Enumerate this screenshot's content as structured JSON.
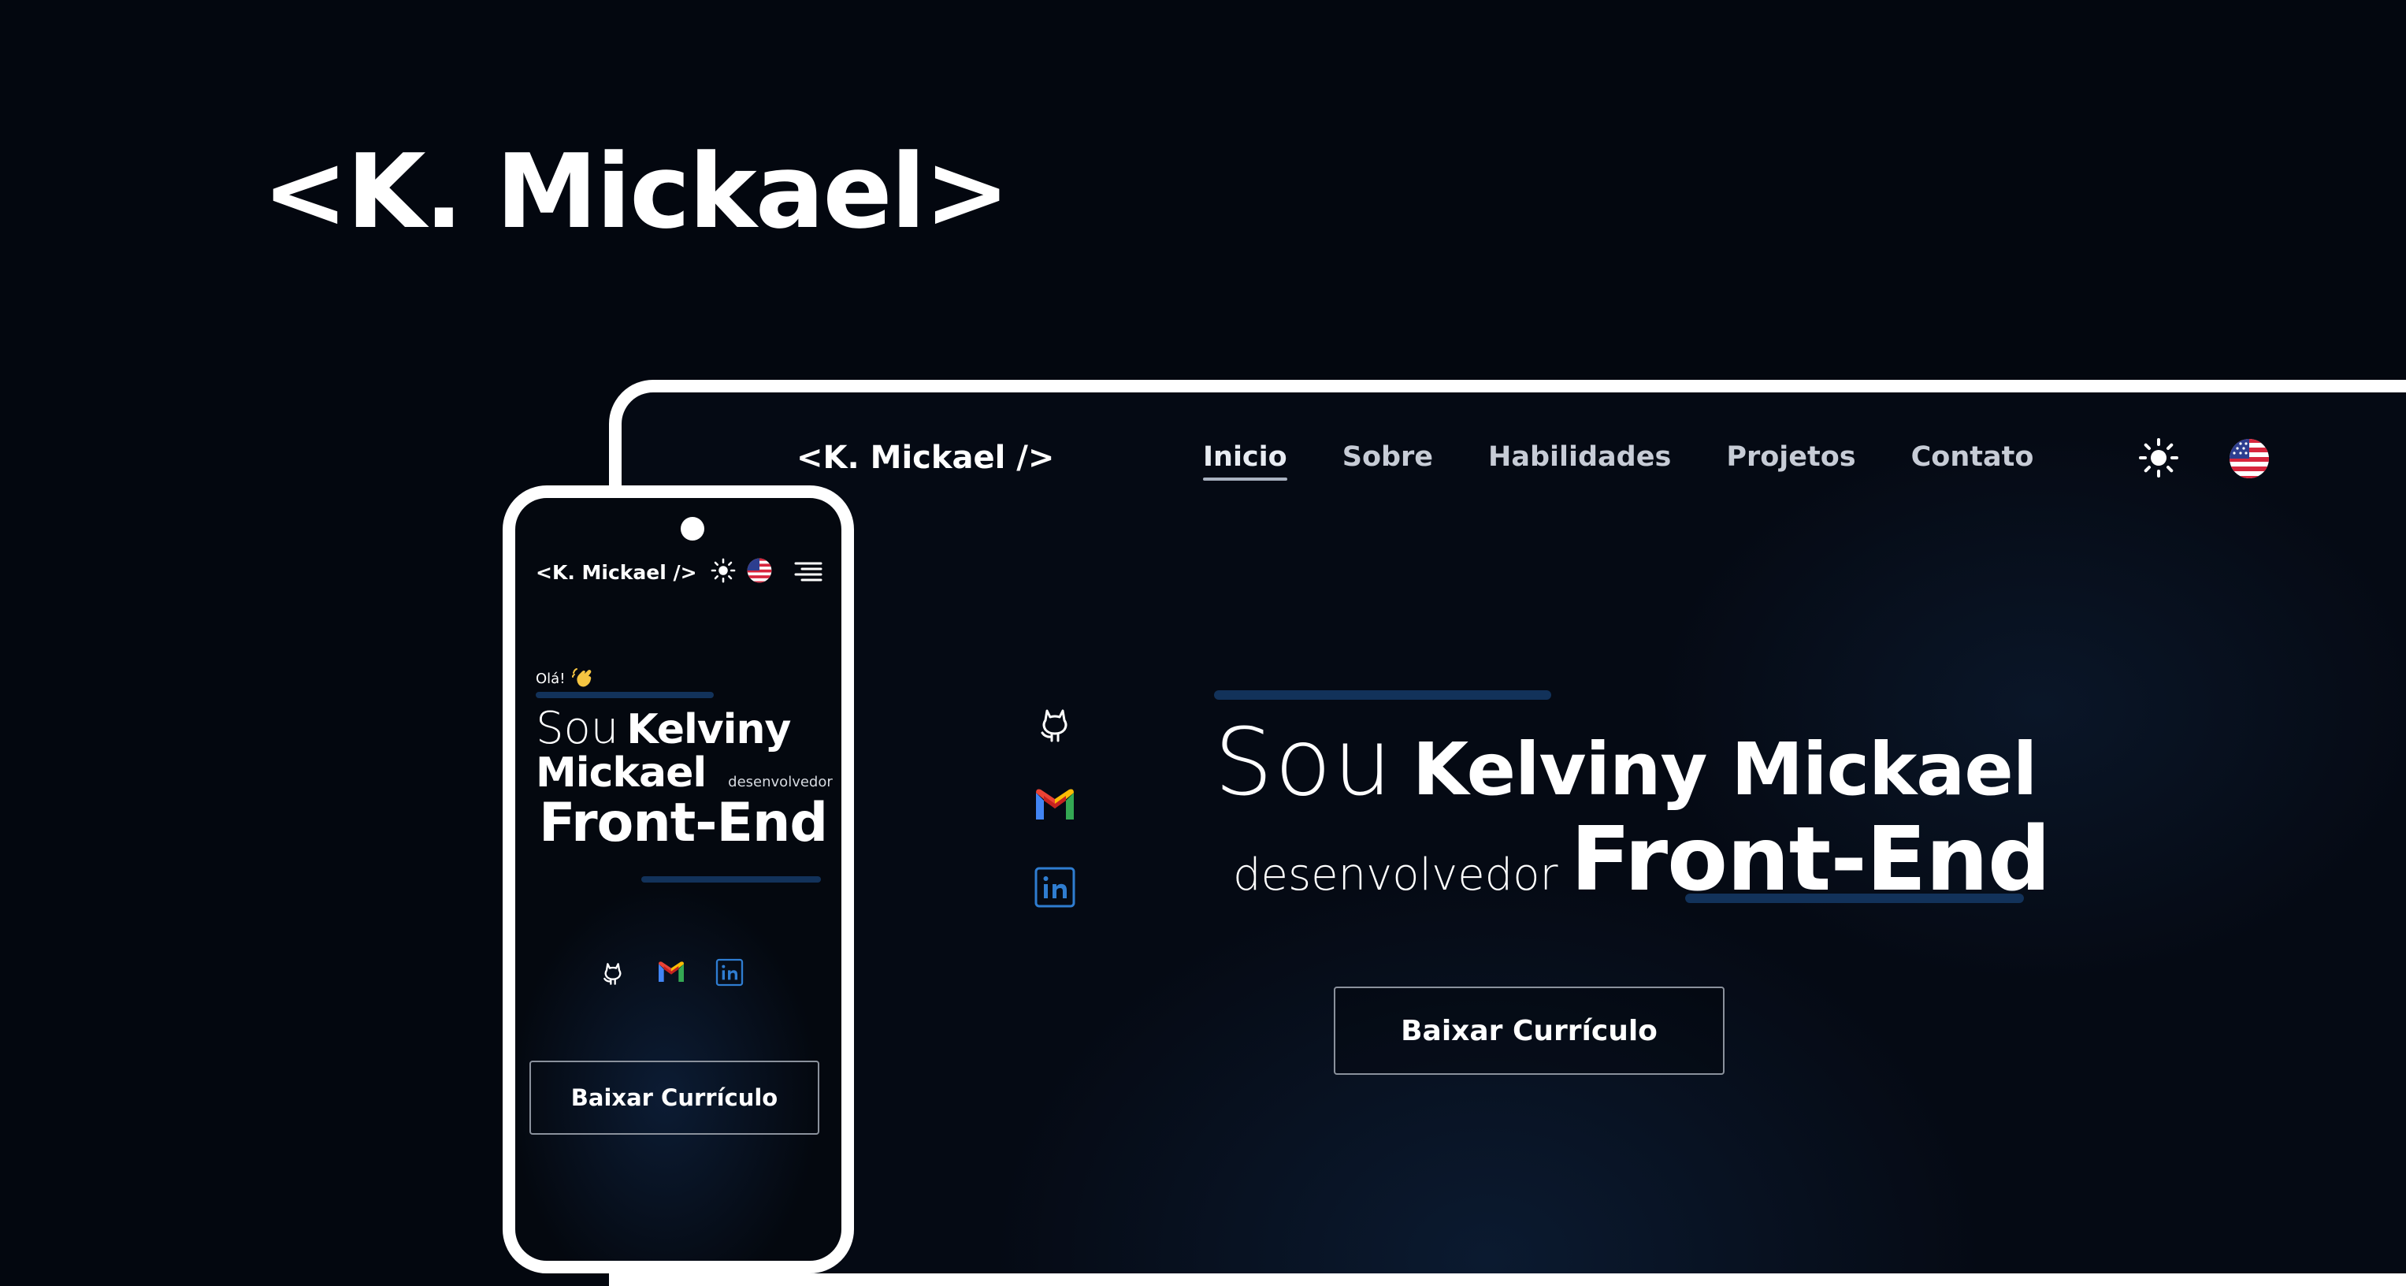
{
  "brand": {
    "title": "<K. Mickael>"
  },
  "desktop": {
    "logo": "<K. Mickael />",
    "nav": [
      "Inicio",
      "Sobre",
      "Habilidades",
      "Projetos",
      "Contato"
    ],
    "active_nav": "Inicio",
    "hero": {
      "prefix": "Sou",
      "name": "Kelviny Mickael",
      "role_prefix": "desenvolvedor",
      "role": "Front-End"
    },
    "cta": "Baixar Currículo",
    "social_icons": [
      "github-icon",
      "gmail-icon",
      "linkedin-icon"
    ],
    "theme_icon": "sun-icon",
    "language_icon": "us-flag-icon"
  },
  "mobile": {
    "logo": "<K. Mickael />",
    "greeting": "Olá!",
    "greeting_icon": "waving-hand-icon",
    "hero": {
      "prefix": "Sou",
      "name_first": "Kelviny",
      "name_last": "Mickael",
      "role_prefix": "desenvolvedor",
      "role": "Front-End"
    },
    "cta": "Baixar Currículo",
    "social_icons": [
      "github-icon",
      "gmail-icon",
      "linkedin-icon"
    ],
    "theme_icon": "sun-icon",
    "language_icon": "us-flag-icon",
    "menu_icon": "hamburger-menu-icon"
  },
  "colors": {
    "background": "#03070f",
    "accent_bar": "#12325a",
    "text": "#ffffff",
    "nav_text": "#c7ccd6",
    "linkedin": "#2f7dd1",
    "button_border": "#8a919c"
  }
}
